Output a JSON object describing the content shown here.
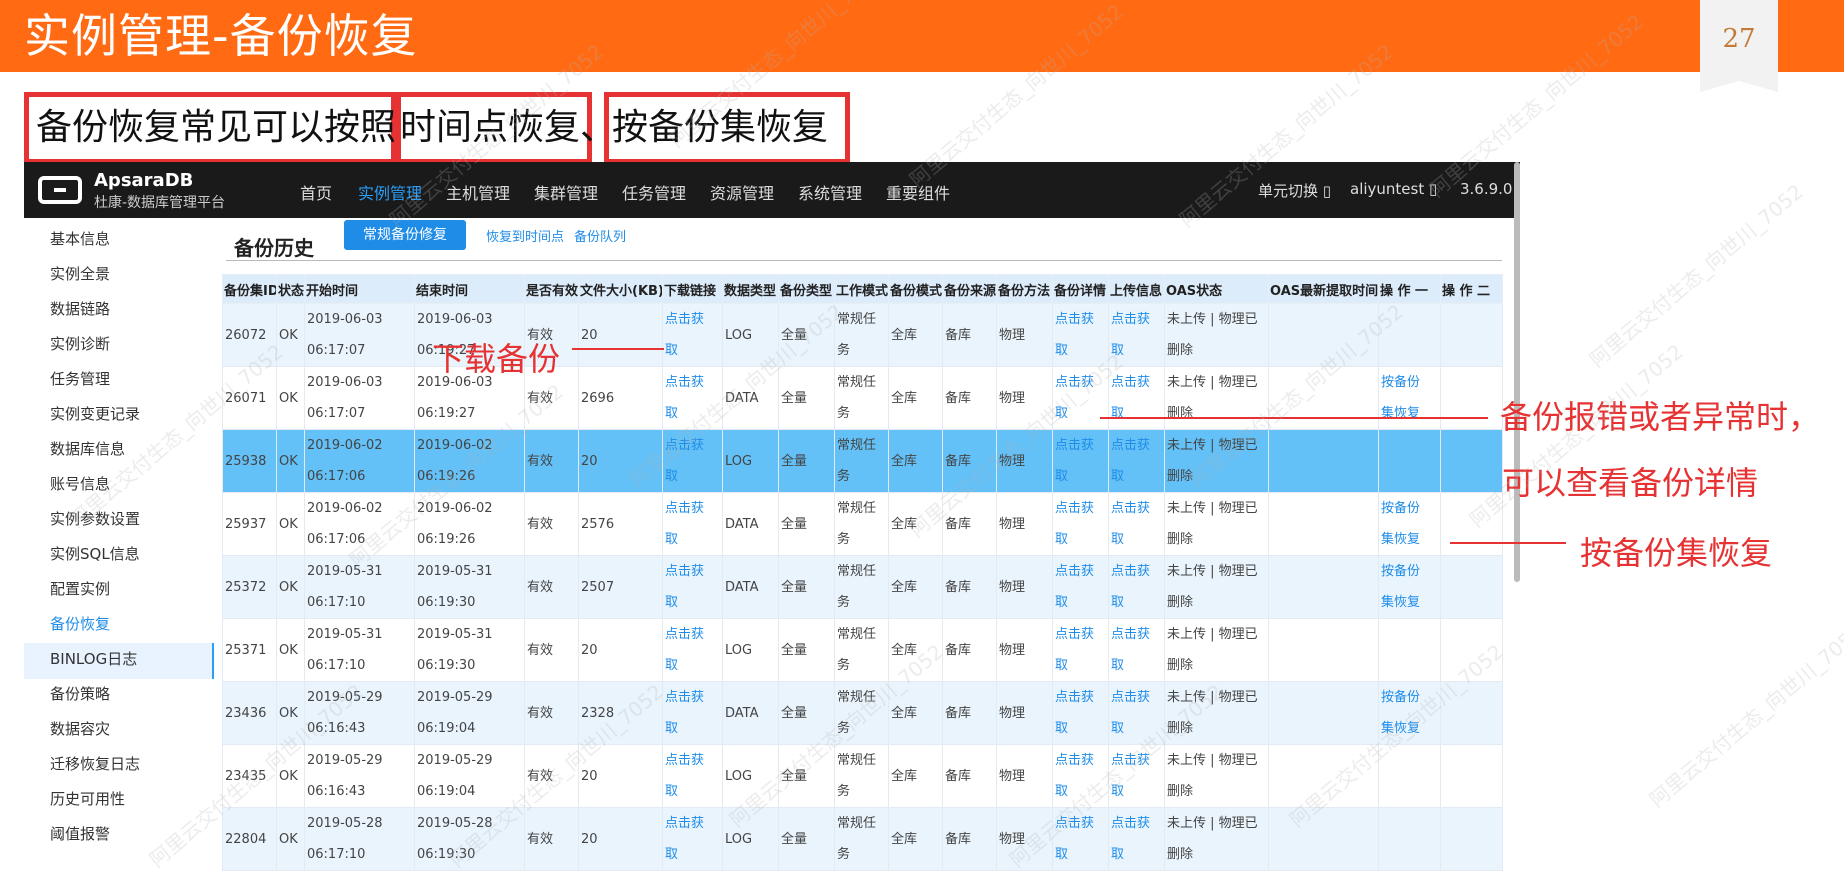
{
  "slide": {
    "title": "实例管理-备份恢复",
    "page_number": "27",
    "accent_color": "#ff6a13"
  },
  "headline": {
    "part1": "备份恢复常见可以按照",
    "part2": "时间点恢复、",
    "part3": "按备份集恢复"
  },
  "app": {
    "brand_name": "ApsaraDB",
    "brand_sub": "杜康-数据库管理平台",
    "nav": [
      "首页",
      "实例管理",
      "主机管理",
      "集群管理",
      "任务管理",
      "资源管理",
      "系统管理",
      "重要组件"
    ],
    "nav_active": "实例管理",
    "unit_switch": "单元切换 ▯",
    "user": "aliyuntest ▯",
    "version": "3.6.9.0"
  },
  "sidebar": {
    "items": [
      "基本信息",
      "实例全景",
      "数据链路",
      "实例诊断",
      "任务管理",
      "实例变更记录",
      "数据库信息",
      "账号信息",
      "实例参数设置",
      "实例SQL信息",
      "配置实例",
      "备份恢复",
      "BINLOG日志",
      "备份策略",
      "数据容灾",
      "迁移恢复日志",
      "历史可用性",
      "阈值报警"
    ],
    "active": "备份恢复"
  },
  "content": {
    "title": "备份历史",
    "tabs": [
      "常规备份修复",
      "恢复到时间点",
      "备份队列"
    ]
  },
  "table": {
    "headers": [
      "备份集ID",
      "状态",
      "开始时间",
      "结束时间",
      "是否有效",
      "文件大小(KB)",
      "下载链接",
      "数据类型",
      "备份类型",
      "工作模式",
      "备份模式",
      "备份来源",
      "备份方法",
      "备份详情",
      "上传信息",
      "OAS状态",
      "OAS最新提取时间",
      "操 作 一",
      "操 作 二"
    ],
    "rows": [
      {
        "id": "26072",
        "status": "OK",
        "start_date": "2019-06-03",
        "start_time": "06:17:07",
        "end_date": "2019-06-03",
        "end_time": "06:19:27",
        "valid": "有效",
        "size": "20",
        "link_a": "点击获",
        "link_b": "取",
        "dtype": "LOG",
        "btype": "全量",
        "work": "常规任务",
        "mode": "全库",
        "source": "备库",
        "method": "物理",
        "detail_a": "点击获",
        "detail_b": "取",
        "upload_a": "点击获",
        "upload_b": "取",
        "oas_a": "未上传 | 物理已",
        "oas_b": "删除",
        "oas_time": "",
        "op1_a": "",
        "op1_b": "",
        "op2": ""
      },
      {
        "id": "26071",
        "status": "OK",
        "start_date": "2019-06-03",
        "start_time": "06:17:07",
        "end_date": "2019-06-03",
        "end_time": "06:19:27",
        "valid": "有效",
        "size": "2696",
        "link_a": "点击获",
        "link_b": "取",
        "dtype": "DATA",
        "btype": "全量",
        "work": "常规任务",
        "mode": "全库",
        "source": "备库",
        "method": "物理",
        "detail_a": "点击获",
        "detail_b": "取",
        "upload_a": "点击获",
        "upload_b": "取",
        "oas_a": "未上传 | 物理已",
        "oas_b": "删除",
        "oas_time": "",
        "op1_a": "按备份",
        "op1_b": "集恢复",
        "op2": ""
      },
      {
        "id": "25938",
        "status": "OK",
        "start_date": "2019-06-02",
        "start_time": "06:17:06",
        "end_date": "2019-06-02",
        "end_time": "06:19:26",
        "valid": "有效",
        "size": "20",
        "link_a": "点击获",
        "link_b": "取",
        "dtype": "LOG",
        "btype": "全量",
        "work": "常规任务",
        "mode": "全库",
        "source": "备库",
        "method": "物理",
        "detail_a": "点击获",
        "detail_b": "取",
        "upload_a": "点击获",
        "upload_b": "取",
        "oas_a": "未上传 | 物理已",
        "oas_b": "删除",
        "oas_time": "",
        "op1_a": "",
        "op1_b": "",
        "op2": ""
      },
      {
        "id": "25937",
        "status": "OK",
        "start_date": "2019-06-02",
        "start_time": "06:17:06",
        "end_date": "2019-06-02",
        "end_time": "06:19:26",
        "valid": "有效",
        "size": "2576",
        "link_a": "点击获",
        "link_b": "取",
        "dtype": "DATA",
        "btype": "全量",
        "work": "常规任务",
        "mode": "全库",
        "source": "备库",
        "method": "物理",
        "detail_a": "点击获",
        "detail_b": "取",
        "upload_a": "点击获",
        "upload_b": "取",
        "oas_a": "未上传 | 物理已",
        "oas_b": "删除",
        "oas_time": "",
        "op1_a": "按备份",
        "op1_b": "集恢复",
        "op2": ""
      },
      {
        "id": "25372",
        "status": "OK",
        "start_date": "2019-05-31",
        "start_time": "06:17:10",
        "end_date": "2019-05-31",
        "end_time": "06:19:30",
        "valid": "有效",
        "size": "2507",
        "link_a": "点击获",
        "link_b": "取",
        "dtype": "DATA",
        "btype": "全量",
        "work": "常规任务",
        "mode": "全库",
        "source": "备库",
        "method": "物理",
        "detail_a": "点击获",
        "detail_b": "取",
        "upload_a": "点击获",
        "upload_b": "取",
        "oas_a": "未上传 | 物理已",
        "oas_b": "删除",
        "oas_time": "",
        "op1_a": "按备份",
        "op1_b": "集恢复",
        "op2": ""
      },
      {
        "id": "25371",
        "status": "OK",
        "start_date": "2019-05-31",
        "start_time": "06:17:10",
        "end_date": "2019-05-31",
        "end_time": "06:19:30",
        "valid": "有效",
        "size": "20",
        "link_a": "点击获",
        "link_b": "取",
        "dtype": "LOG",
        "btype": "全量",
        "work": "常规任务",
        "mode": "全库",
        "source": "备库",
        "method": "物理",
        "detail_a": "点击获",
        "detail_b": "取",
        "upload_a": "点击获",
        "upload_b": "取",
        "oas_a": "未上传 | 物理已",
        "oas_b": "删除",
        "oas_time": "",
        "op1_a": "",
        "op1_b": "",
        "op2": ""
      },
      {
        "id": "23436",
        "status": "OK",
        "start_date": "2019-05-29",
        "start_time": "06:16:43",
        "end_date": "2019-05-29",
        "end_time": "06:19:04",
        "valid": "有效",
        "size": "2328",
        "link_a": "点击获",
        "link_b": "取",
        "dtype": "DATA",
        "btype": "全量",
        "work": "常规任务",
        "mode": "全库",
        "source": "备库",
        "method": "物理",
        "detail_a": "点击获",
        "detail_b": "取",
        "upload_a": "点击获",
        "upload_b": "取",
        "oas_a": "未上传 | 物理已",
        "oas_b": "删除",
        "oas_time": "",
        "op1_a": "按备份",
        "op1_b": "集恢复",
        "op2": ""
      },
      {
        "id": "23435",
        "status": "OK",
        "start_date": "2019-05-29",
        "start_time": "06:16:43",
        "end_date": "2019-05-29",
        "end_time": "06:19:04",
        "valid": "有效",
        "size": "20",
        "link_a": "点击获",
        "link_b": "取",
        "dtype": "LOG",
        "btype": "全量",
        "work": "常规任务",
        "mode": "全库",
        "source": "备库",
        "method": "物理",
        "detail_a": "点击获",
        "detail_b": "取",
        "upload_a": "点击获",
        "upload_b": "取",
        "oas_a": "未上传 | 物理已",
        "oas_b": "删除",
        "oas_time": "",
        "op1_a": "",
        "op1_b": "",
        "op2": ""
      },
      {
        "id": "22804",
        "status": "OK",
        "start_date": "2019-05-28",
        "start_time": "06:17:10",
        "end_date": "2019-05-28",
        "end_time": "06:19:30",
        "valid": "有效",
        "size": "20",
        "link_a": "点击获",
        "link_b": "取",
        "dtype": "LOG",
        "btype": "全量",
        "work": "常规任务",
        "mode": "全库",
        "source": "备库",
        "method": "物理",
        "detail_a": "点击获",
        "detail_b": "取",
        "upload_a": "点击获",
        "upload_b": "取",
        "oas_a": "未上传 | 物理已",
        "oas_b": "删除",
        "oas_time": "",
        "op1_a": "",
        "op1_b": "",
        "op2": ""
      }
    ],
    "selected_id": "25938"
  },
  "annotations": {
    "download": "下载备份",
    "detail_line1": "备份报错或者异常时，",
    "detail_line2": "可以查看备份详情",
    "restore_set": "按备份集恢复",
    "color": "#e63232"
  },
  "watermark": "阿里云交付生态_向世川_7052"
}
